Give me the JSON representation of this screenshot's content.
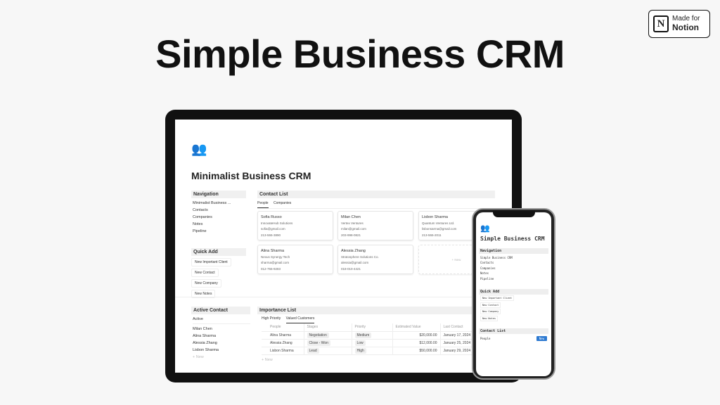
{
  "headline": "Simple Business CRM",
  "badge": {
    "line1": "Made for",
    "line2": "Notion",
    "logo": "N"
  },
  "tablet": {
    "page_icon": "people-icon",
    "page_title": "Minimalist Business CRM",
    "navigation": {
      "heading": "Navigation",
      "items": [
        "Minimalist Business ...",
        "Contacts",
        "Companies",
        "Notes",
        "Pipeline"
      ]
    },
    "quick_add": {
      "heading": "Quick Add",
      "items": [
        "New Important Client",
        "New Contact",
        "New Company",
        "New Notes"
      ]
    },
    "contact_list": {
      "heading": "Contact List",
      "tabs": [
        "People",
        "Companies"
      ],
      "cards": [
        {
          "name": "Sofia Russo",
          "company": "InnovateHub Solutions",
          "email": "sofia@gmail.com",
          "phone": "213-555-3890"
        },
        {
          "name": "Milan Chen",
          "company": "Vertex Ventures",
          "email": "milan@gmail.com",
          "phone": "203-998-0821"
        },
        {
          "name": "Lisbon Sharma",
          "company": "Quantum Ventures Ltd.",
          "email": "lisbonsarma@gmail.com",
          "phone": "213-555-2011"
        },
        {
          "name": "Alina Sharma",
          "company": "Nexus Synergy Tech",
          "email": "sharma@gmail.com",
          "phone": "012-755-9283"
        },
        {
          "name": "Alessia Zhang",
          "company": "Stratosphere Solutions Co.",
          "email": "alessia@gmail.com",
          "phone": "018-010-4421"
        }
      ],
      "new_label": "+ New"
    },
    "active_contact": {
      "heading": "Active Contact",
      "filter": "Active",
      "items": [
        "Milan Chen",
        "Alina Sharma",
        "Alessia Zhang",
        "Lisbon Sharma"
      ],
      "new_label": "+ New"
    },
    "importance_list": {
      "heading": "Importance List",
      "tabs": [
        "High Priority",
        "Valued Customers"
      ],
      "columns": [
        "People",
        "Stages",
        "Priority",
        "Estimated Value",
        "Last Contact"
      ],
      "rows": [
        [
          "Alina Sharma",
          "Negotiation",
          "Medium",
          "$20,000.00",
          "January 17, 2024"
        ],
        [
          "Alessia Zhang",
          "Close - Won",
          "Low",
          "$12,000.00",
          "January 25, 2024"
        ],
        [
          "Lisbon Sharma",
          "Lead",
          "High",
          "$50,000.00",
          "January 29, 2024"
        ]
      ],
      "new_label": "+ New"
    }
  },
  "phone": {
    "page_title": "Simple Business CRM",
    "navigation": {
      "heading": "Navigation",
      "items": [
        "Simple Business CRM",
        "Contacts",
        "Companies",
        "Notes",
        "Pipeline"
      ]
    },
    "quick_add": {
      "heading": "Quick Add",
      "items": [
        "New Important Client",
        "New Contact",
        "New Company",
        "New Notes"
      ]
    },
    "contact_list": {
      "heading": "Contact List",
      "tab": "People",
      "button": "New"
    },
    "accent": "#2e7ad1"
  }
}
